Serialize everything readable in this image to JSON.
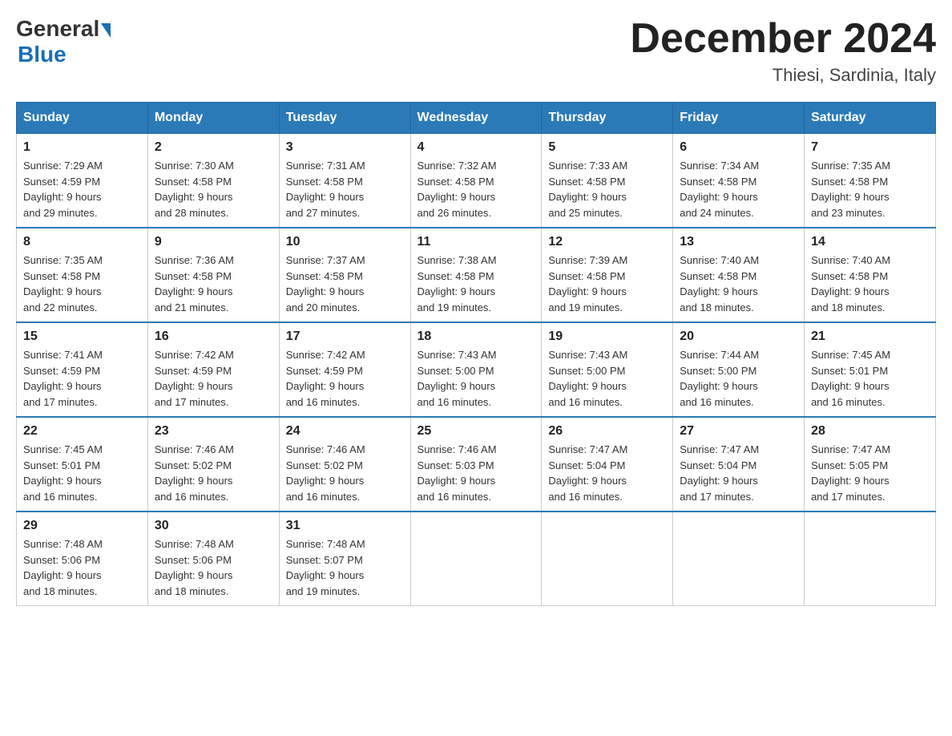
{
  "header": {
    "logo": {
      "general": "General",
      "blue": "Blue"
    },
    "title": "December 2024",
    "location": "Thiesi, Sardinia, Italy"
  },
  "days_of_week": [
    "Sunday",
    "Monday",
    "Tuesday",
    "Wednesday",
    "Thursday",
    "Friday",
    "Saturday"
  ],
  "weeks": [
    [
      {
        "day": "1",
        "sunrise": "7:29 AM",
        "sunset": "4:59 PM",
        "daylight": "9 hours and 29 minutes."
      },
      {
        "day": "2",
        "sunrise": "7:30 AM",
        "sunset": "4:58 PM",
        "daylight": "9 hours and 28 minutes."
      },
      {
        "day": "3",
        "sunrise": "7:31 AM",
        "sunset": "4:58 PM",
        "daylight": "9 hours and 27 minutes."
      },
      {
        "day": "4",
        "sunrise": "7:32 AM",
        "sunset": "4:58 PM",
        "daylight": "9 hours and 26 minutes."
      },
      {
        "day": "5",
        "sunrise": "7:33 AM",
        "sunset": "4:58 PM",
        "daylight": "9 hours and 25 minutes."
      },
      {
        "day": "6",
        "sunrise": "7:34 AM",
        "sunset": "4:58 PM",
        "daylight": "9 hours and 24 minutes."
      },
      {
        "day": "7",
        "sunrise": "7:35 AM",
        "sunset": "4:58 PM",
        "daylight": "9 hours and 23 minutes."
      }
    ],
    [
      {
        "day": "8",
        "sunrise": "7:35 AM",
        "sunset": "4:58 PM",
        "daylight": "9 hours and 22 minutes."
      },
      {
        "day": "9",
        "sunrise": "7:36 AM",
        "sunset": "4:58 PM",
        "daylight": "9 hours and 21 minutes."
      },
      {
        "day": "10",
        "sunrise": "7:37 AM",
        "sunset": "4:58 PM",
        "daylight": "9 hours and 20 minutes."
      },
      {
        "day": "11",
        "sunrise": "7:38 AM",
        "sunset": "4:58 PM",
        "daylight": "9 hours and 19 minutes."
      },
      {
        "day": "12",
        "sunrise": "7:39 AM",
        "sunset": "4:58 PM",
        "daylight": "9 hours and 19 minutes."
      },
      {
        "day": "13",
        "sunrise": "7:40 AM",
        "sunset": "4:58 PM",
        "daylight": "9 hours and 18 minutes."
      },
      {
        "day": "14",
        "sunrise": "7:40 AM",
        "sunset": "4:58 PM",
        "daylight": "9 hours and 18 minutes."
      }
    ],
    [
      {
        "day": "15",
        "sunrise": "7:41 AM",
        "sunset": "4:59 PM",
        "daylight": "9 hours and 17 minutes."
      },
      {
        "day": "16",
        "sunrise": "7:42 AM",
        "sunset": "4:59 PM",
        "daylight": "9 hours and 17 minutes."
      },
      {
        "day": "17",
        "sunrise": "7:42 AM",
        "sunset": "4:59 PM",
        "daylight": "9 hours and 16 minutes."
      },
      {
        "day": "18",
        "sunrise": "7:43 AM",
        "sunset": "5:00 PM",
        "daylight": "9 hours and 16 minutes."
      },
      {
        "day": "19",
        "sunrise": "7:43 AM",
        "sunset": "5:00 PM",
        "daylight": "9 hours and 16 minutes."
      },
      {
        "day": "20",
        "sunrise": "7:44 AM",
        "sunset": "5:00 PM",
        "daylight": "9 hours and 16 minutes."
      },
      {
        "day": "21",
        "sunrise": "7:45 AM",
        "sunset": "5:01 PM",
        "daylight": "9 hours and 16 minutes."
      }
    ],
    [
      {
        "day": "22",
        "sunrise": "7:45 AM",
        "sunset": "5:01 PM",
        "daylight": "9 hours and 16 minutes."
      },
      {
        "day": "23",
        "sunrise": "7:46 AM",
        "sunset": "5:02 PM",
        "daylight": "9 hours and 16 minutes."
      },
      {
        "day": "24",
        "sunrise": "7:46 AM",
        "sunset": "5:02 PM",
        "daylight": "9 hours and 16 minutes."
      },
      {
        "day": "25",
        "sunrise": "7:46 AM",
        "sunset": "5:03 PM",
        "daylight": "9 hours and 16 minutes."
      },
      {
        "day": "26",
        "sunrise": "7:47 AM",
        "sunset": "5:04 PM",
        "daylight": "9 hours and 16 minutes."
      },
      {
        "day": "27",
        "sunrise": "7:47 AM",
        "sunset": "5:04 PM",
        "daylight": "9 hours and 17 minutes."
      },
      {
        "day": "28",
        "sunrise": "7:47 AM",
        "sunset": "5:05 PM",
        "daylight": "9 hours and 17 minutes."
      }
    ],
    [
      {
        "day": "29",
        "sunrise": "7:48 AM",
        "sunset": "5:06 PM",
        "daylight": "9 hours and 18 minutes."
      },
      {
        "day": "30",
        "sunrise": "7:48 AM",
        "sunset": "5:06 PM",
        "daylight": "9 hours and 18 minutes."
      },
      {
        "day": "31",
        "sunrise": "7:48 AM",
        "sunset": "5:07 PM",
        "daylight": "9 hours and 19 minutes."
      },
      null,
      null,
      null,
      null
    ]
  ],
  "labels": {
    "sunrise": "Sunrise:",
    "sunset": "Sunset:",
    "daylight": "Daylight:"
  }
}
